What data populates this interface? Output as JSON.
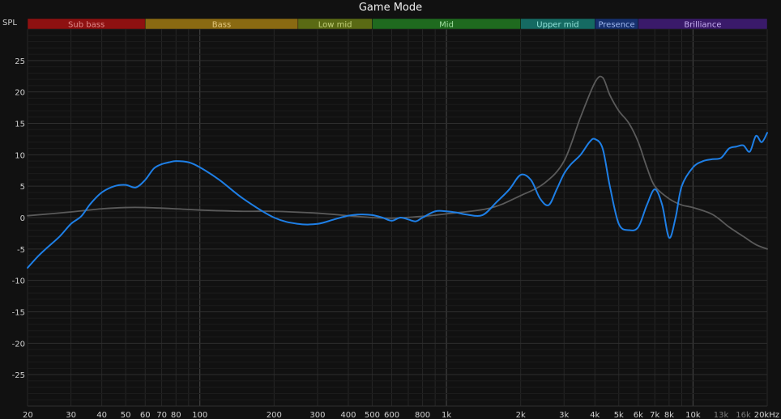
{
  "chart_data": {
    "type": "line",
    "title": "Game Mode",
    "ylabel": "SPL",
    "xlabel": "",
    "xscale": "log",
    "xlim": [
      20,
      20000
    ],
    "ylim": [
      -30,
      30
    ],
    "grid": true,
    "x_ticks": [
      {
        "label": "20",
        "value": 20
      },
      {
        "label": "30",
        "value": 30
      },
      {
        "label": "40",
        "value": 40
      },
      {
        "label": "50",
        "value": 50
      },
      {
        "label": "60",
        "value": 60
      },
      {
        "label": "70",
        "value": 70
      },
      {
        "label": "80",
        "value": 80
      },
      {
        "label": "100",
        "value": 100
      },
      {
        "label": "200",
        "value": 200
      },
      {
        "label": "300",
        "value": 300
      },
      {
        "label": "400",
        "value": 400
      },
      {
        "label": "500",
        "value": 500
      },
      {
        "label": "600",
        "value": 600
      },
      {
        "label": "800",
        "value": 800
      },
      {
        "label": "1k",
        "value": 1000
      },
      {
        "label": "2k",
        "value": 2000
      },
      {
        "label": "3k",
        "value": 3000
      },
      {
        "label": "4k",
        "value": 4000
      },
      {
        "label": "5k",
        "value": 5000
      },
      {
        "label": "6k",
        "value": 6000
      },
      {
        "label": "7k",
        "value": 7000
      },
      {
        "label": "8k",
        "value": 8000
      },
      {
        "label": "10k",
        "value": 10000
      },
      {
        "label": "13k",
        "value": 13000,
        "faded": true
      },
      {
        "label": "16k",
        "value": 16000,
        "faded": true
      },
      {
        "label": "20kHz",
        "value": 20000
      }
    ],
    "y_ticks": [
      25,
      20,
      15,
      10,
      5,
      0,
      -5,
      -10,
      -15,
      -20,
      -25
    ],
    "bands": [
      {
        "label": "Sub bass",
        "from": 20,
        "to": 60,
        "color": "#8e1111",
        "text_color": "#e08a8a"
      },
      {
        "label": "Bass",
        "from": 60,
        "to": 250,
        "color": "#8a6a12",
        "text_color": "#e2c77d"
      },
      {
        "label": "Low mid",
        "from": 250,
        "to": 500,
        "color": "#5a6a14",
        "text_color": "#c3d07a"
      },
      {
        "label": "Mid",
        "from": 500,
        "to": 2000,
        "color": "#1f6a1f",
        "text_color": "#9fdc9f"
      },
      {
        "label": "Upper mid",
        "from": 2000,
        "to": 4000,
        "color": "#156a62",
        "text_color": "#8fe0d6"
      },
      {
        "label": "Presence",
        "from": 4000,
        "to": 6000,
        "color": "#16306e",
        "text_color": "#9fb7ee"
      },
      {
        "label": "Brilliance",
        "from": 6000,
        "to": 20000,
        "color": "#3a1a6a",
        "text_color": "#c6aef0"
      }
    ],
    "series": [
      {
        "color": "#1e7fe6",
        "x": [
          20,
          22,
          24,
          27,
          30,
          33,
          36,
          40,
          45,
          50,
          55,
          60,
          65,
          70,
          75,
          80,
          90,
          100,
          120,
          150,
          200,
          250,
          300,
          350,
          400,
          450,
          500,
          550,
          600,
          650,
          700,
          750,
          800,
          900,
          1000,
          1100,
          1200,
          1400,
          1600,
          1800,
          2000,
          2200,
          2400,
          2600,
          2800,
          3000,
          3200,
          3500,
          3800,
          4000,
          4300,
          4600,
          5000,
          5500,
          6000,
          6500,
          7000,
          7500,
          8000,
          8500,
          9000,
          10000,
          11000,
          12000,
          13000,
          14000,
          15000,
          16000,
          17000,
          18000,
          19000,
          20000
        ],
        "y": [
          -8,
          -6.2,
          -4.8,
          -3,
          -1,
          0.2,
          2.2,
          4,
          5,
          5.2,
          4.8,
          6,
          7.8,
          8.5,
          8.8,
          9,
          8.8,
          8,
          6,
          3,
          0,
          -1,
          -1,
          -0.3,
          0.3,
          0.5,
          0.4,
          0,
          -0.5,
          0,
          -0.3,
          -0.6,
          0,
          1,
          1,
          0.8,
          0.5,
          0.4,
          2.5,
          4.5,
          6.8,
          6,
          3,
          2,
          4.5,
          7,
          8.5,
          10,
          12,
          12.5,
          11,
          5,
          -1,
          -2,
          -1.5,
          2,
          4.5,
          2,
          -3.2,
          0,
          5,
          8,
          9,
          9.3,
          9.5,
          11,
          11.3,
          11.5,
          10.5,
          13,
          12,
          13.5
        ]
      },
      {
        "color": "#5a5a5a",
        "x": [
          20,
          30,
          40,
          50,
          60,
          80,
          100,
          150,
          200,
          300,
          400,
          500,
          600,
          800,
          1000,
          1500,
          2000,
          2500,
          3000,
          3500,
          4000,
          4300,
          4600,
          5000,
          5500,
          6000,
          6500,
          7000,
          8000,
          9000,
          10000,
          12000,
          14000,
          16000,
          18000,
          20000
        ],
        "y": [
          0.3,
          0.9,
          1.4,
          1.6,
          1.6,
          1.4,
          1.2,
          1.0,
          1.0,
          0.7,
          0.3,
          0.0,
          -0.1,
          0.2,
          0.6,
          1.5,
          3.5,
          5.5,
          9,
          16,
          21.5,
          22.3,
          19.5,
          17,
          15,
          12,
          8,
          5,
          3,
          2,
          1.6,
          0.5,
          -1.5,
          -3,
          -4.3,
          -5
        ]
      }
    ]
  }
}
